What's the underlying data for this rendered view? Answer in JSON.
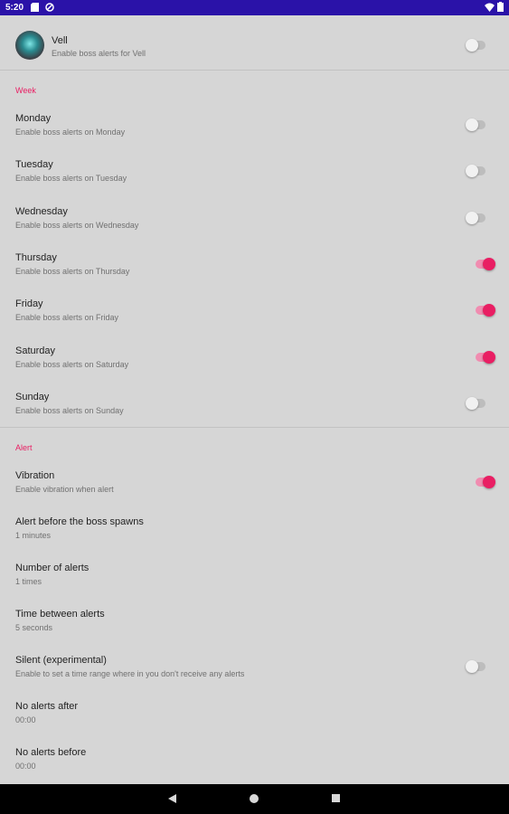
{
  "status_bar": {
    "time": "5:20"
  },
  "header": {
    "title": "Vell",
    "subtitle": "Enable boss alerts for Vell",
    "enabled": false
  },
  "week": {
    "section_label": "Week",
    "days": [
      {
        "title": "Monday",
        "subtitle": "Enable boss alerts on Monday",
        "enabled": false
      },
      {
        "title": "Tuesday",
        "subtitle": "Enable boss alerts on Tuesday",
        "enabled": false
      },
      {
        "title": "Wednesday",
        "subtitle": "Enable boss alerts on Wednesday",
        "enabled": false
      },
      {
        "title": "Thursday",
        "subtitle": "Enable boss alerts on Thursday",
        "enabled": true
      },
      {
        "title": "Friday",
        "subtitle": "Enable boss alerts on Friday",
        "enabled": true
      },
      {
        "title": "Saturday",
        "subtitle": "Enable boss alerts on Saturday",
        "enabled": true
      },
      {
        "title": "Sunday",
        "subtitle": "Enable boss alerts on Sunday",
        "enabled": false
      }
    ]
  },
  "alert": {
    "section_label": "Alert",
    "vibration": {
      "title": "Vibration",
      "subtitle": "Enable vibration when alert",
      "enabled": true
    },
    "before_spawn": {
      "title": "Alert before the boss spawns",
      "value": "1 minutes"
    },
    "number": {
      "title": "Number of alerts",
      "value": "1 times"
    },
    "time_between": {
      "title": "Time between alerts",
      "value": "5 seconds"
    },
    "silent": {
      "title": "Silent (experimental)",
      "subtitle": "Enable to set a time range where in you don't receive any alerts",
      "enabled": false
    },
    "no_after": {
      "title": "No alerts after",
      "value": "00:00"
    },
    "no_before": {
      "title": "No alerts before",
      "value": "00:00"
    }
  },
  "colors": {
    "accent": "#e91e63",
    "status_bar": "#2a12a8",
    "background": "#d6d6d6"
  },
  "icons": {
    "nav": [
      "back-icon",
      "home-icon",
      "recents-icon"
    ],
    "status": [
      "wifi-icon",
      "battery-icon"
    ]
  }
}
